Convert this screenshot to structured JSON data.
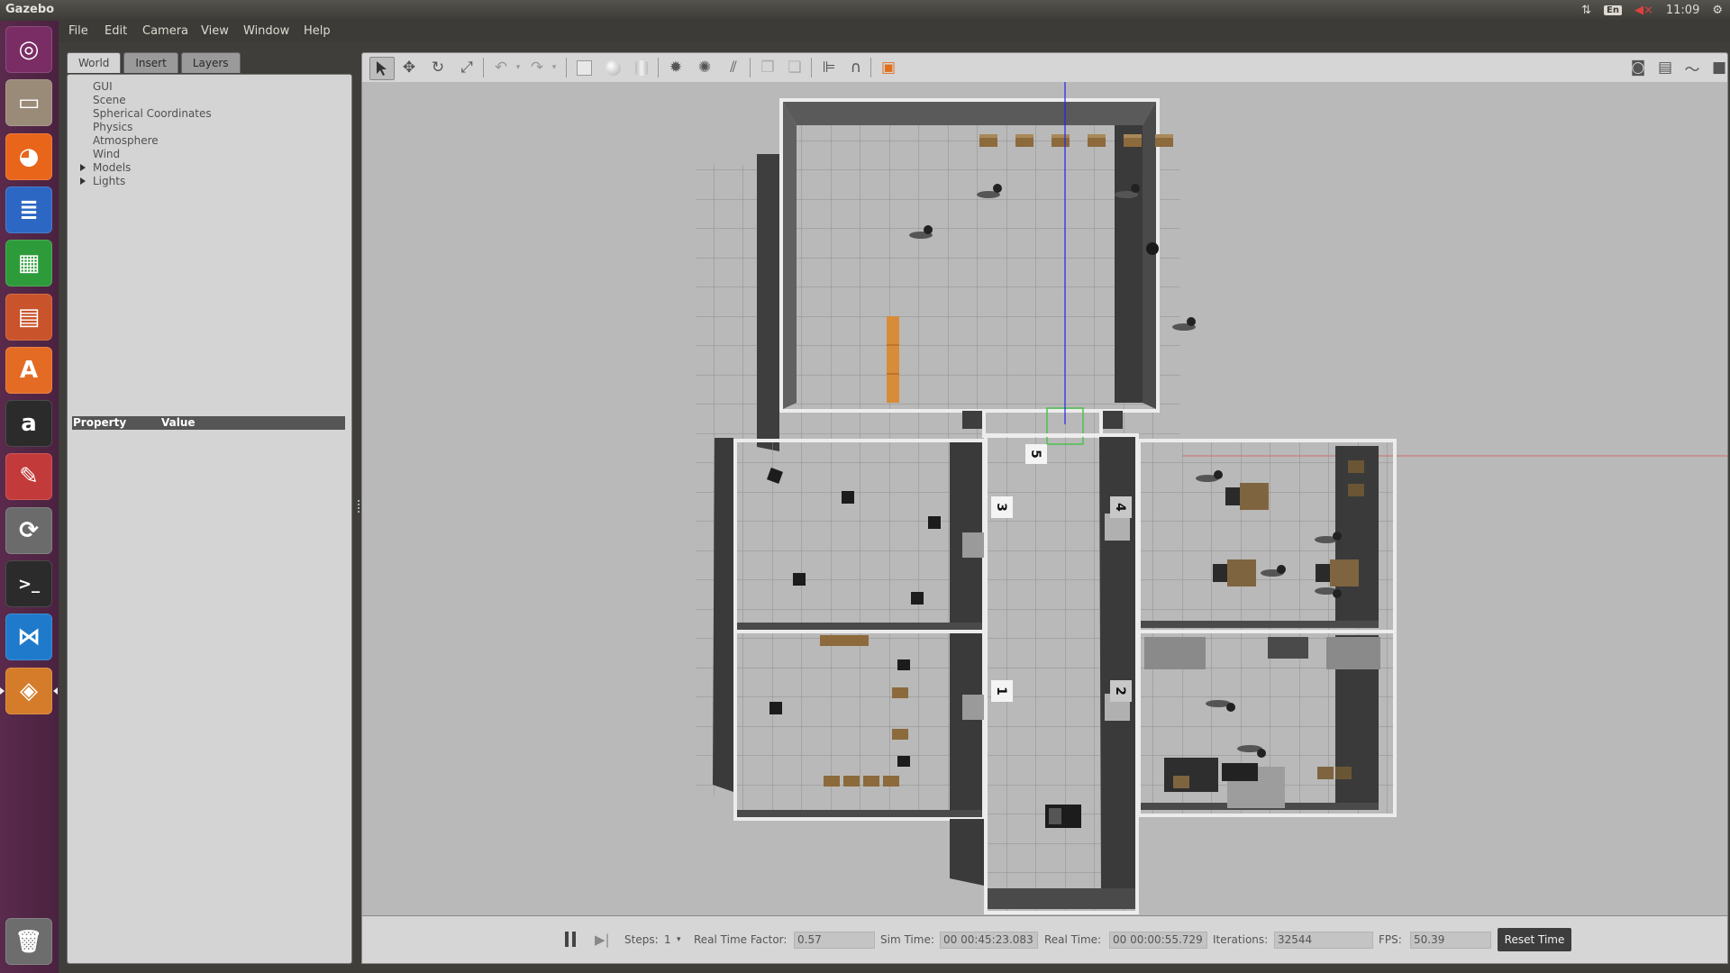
{
  "os": {
    "app_title": "Gazebo",
    "tray": {
      "network_icon": "up-down-arrows-icon",
      "keyboard": "En",
      "volume_icon": "speaker-muted-icon",
      "clock": "11:09",
      "settings_icon": "gear-icon"
    },
    "launcher": [
      {
        "name": "ubuntu-dash",
        "icon": "ubuntu-logo-icon",
        "color": "#7a2d64"
      },
      {
        "name": "files",
        "icon": "file-cabinet-icon",
        "color": "#9a8a78"
      },
      {
        "name": "firefox",
        "icon": "firefox-icon",
        "color": "#e8651a"
      },
      {
        "name": "writer",
        "icon": "document-icon",
        "color": "#2d67c4"
      },
      {
        "name": "calc",
        "icon": "spreadsheet-icon",
        "color": "#2e9b3a"
      },
      {
        "name": "impress",
        "icon": "presentation-icon",
        "color": "#c9532a"
      },
      {
        "name": "software-center",
        "icon": "shopping-bag-icon",
        "color": "#e46b24"
      },
      {
        "name": "amazon",
        "icon": "amazon-icon",
        "color": "#2b2b2b"
      },
      {
        "name": "system-settings",
        "icon": "wrench-icon",
        "color": "#c33a3a"
      },
      {
        "name": "software-updater",
        "icon": "updater-icon",
        "color": "#6b6b6b"
      },
      {
        "name": "terminal",
        "icon": "terminal-icon",
        "color": "#2b2b2b"
      },
      {
        "name": "vscode",
        "icon": "vscode-icon",
        "color": "#1f7acb"
      },
      {
        "name": "gazebo",
        "icon": "gazebo-icon",
        "color": "#d47c2a"
      }
    ],
    "trash_icon": "trash-icon"
  },
  "menu": [
    "File",
    "Edit",
    "Camera",
    "View",
    "Window",
    "Help"
  ],
  "left_panel": {
    "tabs": [
      "World",
      "Insert",
      "Layers"
    ],
    "active_tab": "World",
    "tree": [
      {
        "label": "GUI",
        "expandable": false
      },
      {
        "label": "Scene",
        "expandable": false
      },
      {
        "label": "Spherical Coordinates",
        "expandable": false
      },
      {
        "label": "Physics",
        "expandable": false
      },
      {
        "label": "Atmosphere",
        "expandable": false
      },
      {
        "label": "Wind",
        "expandable": false
      },
      {
        "label": "Models",
        "expandable": true
      },
      {
        "label": "Lights",
        "expandable": true
      }
    ],
    "property_header": {
      "property": "Property",
      "value": "Value"
    }
  },
  "toolbar": {
    "left": [
      "select-arrow-icon",
      "translate-icon",
      "rotate-icon",
      "scale-icon",
      "undo-icon",
      "dropdown-icon",
      "redo-icon",
      "dropdown-icon",
      "box-icon",
      "sphere-icon",
      "cylinder-icon",
      "point-light-icon",
      "spot-light-icon",
      "directional-light-icon",
      "copy-icon",
      "paste-icon",
      "align-icon",
      "snap-icon",
      "view-angle-icon"
    ],
    "right": [
      "screenshot-icon",
      "log-icon",
      "plot-icon",
      "record-video-icon"
    ]
  },
  "room_labels": [
    "5",
    "3",
    "4",
    "1",
    "2"
  ],
  "bottom": {
    "steps_label": "Steps:",
    "steps_value": "1",
    "rtf_label": "Real Time Factor:",
    "rtf_value": "0.57",
    "sim_time_label": "Sim Time:",
    "sim_time_value": "00 00:45:23.083",
    "real_time_label": "Real Time:",
    "real_time_value": "00 00:00:55.729",
    "iterations_label": "Iterations:",
    "iterations_value": "32544",
    "fps_label": "FPS:",
    "fps_value": "50.39",
    "reset_label": "Reset Time"
  }
}
